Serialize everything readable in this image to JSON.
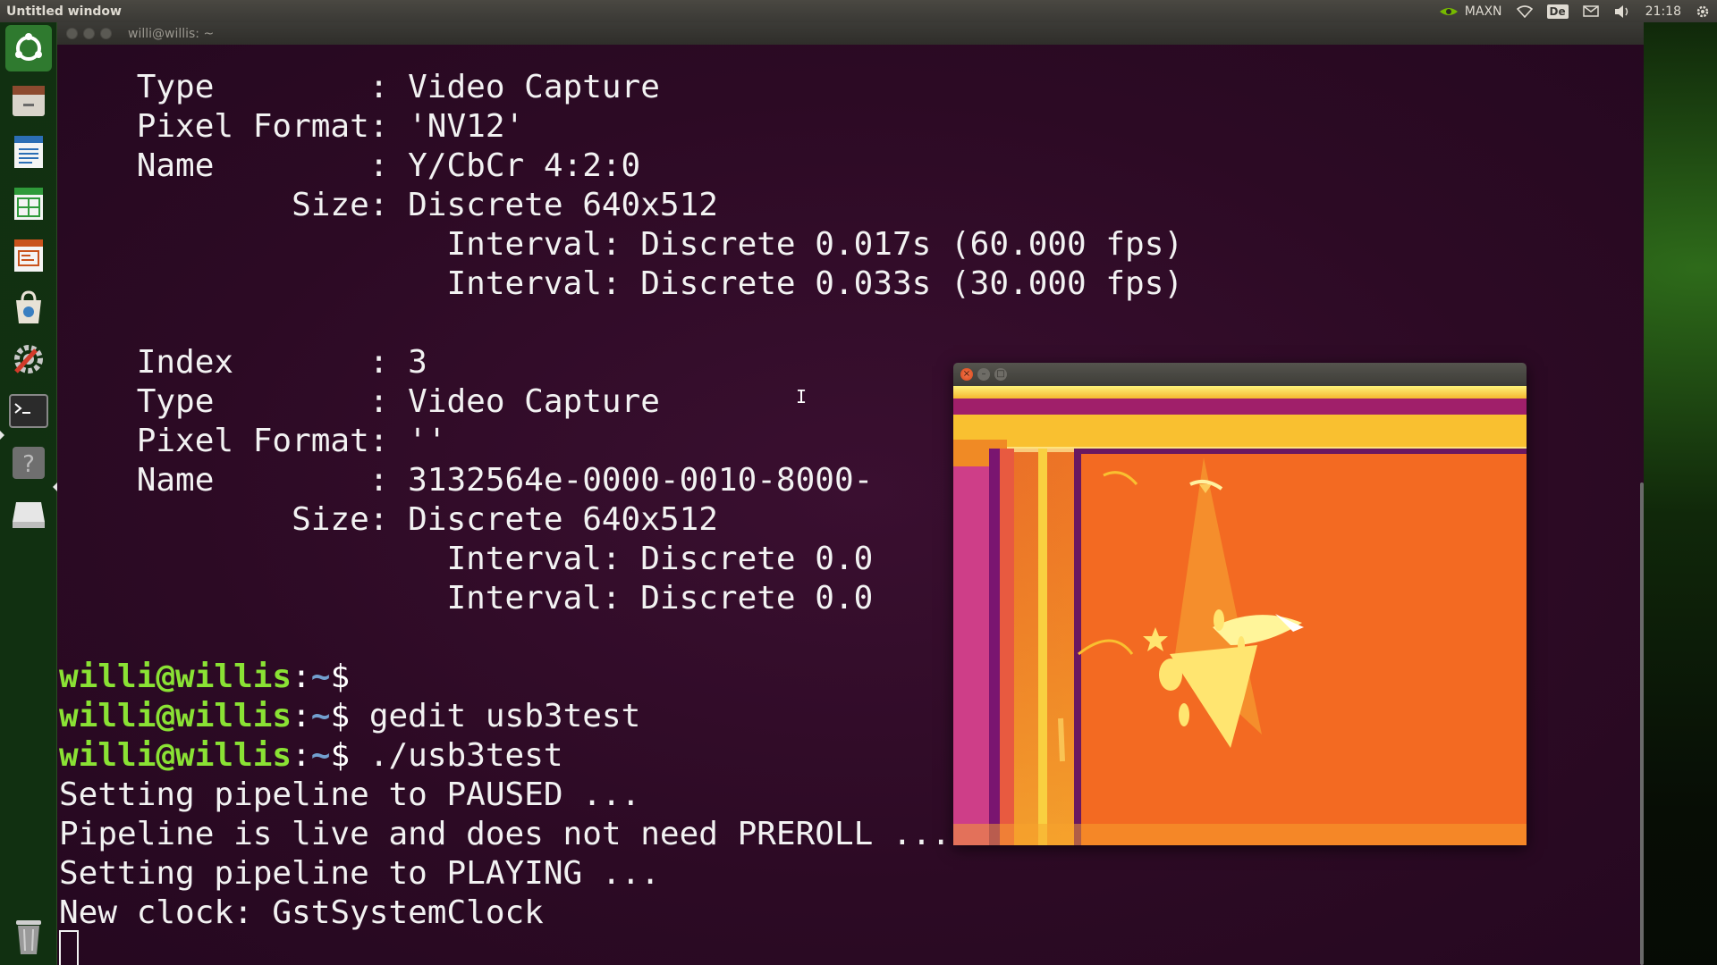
{
  "top_panel": {
    "window_title": "Untitled window",
    "power_mode": "MAXN",
    "keyboard_layout": "De",
    "clock": "21:18",
    "icons": [
      "nvidia-icon",
      "wifi-icon",
      "keyboard-icon",
      "mail-icon",
      "volume-icon",
      "gear-icon"
    ]
  },
  "launcher": {
    "items": [
      {
        "name": "ubuntu-dash-icon"
      },
      {
        "name": "file-manager-icon"
      },
      {
        "name": "writer-icon"
      },
      {
        "name": "calc-icon"
      },
      {
        "name": "impress-icon"
      },
      {
        "name": "software-center-icon"
      },
      {
        "name": "system-settings-icon"
      },
      {
        "name": "terminal-icon"
      },
      {
        "name": "help-icon"
      },
      {
        "name": "drive-icon"
      },
      {
        "name": "trash-icon"
      }
    ]
  },
  "terminal": {
    "title": "willi@willis: ~",
    "lines": [
      "    Type        : Video Capture",
      "    Pixel Format: 'NV12'",
      "    Name        : Y/CbCr 4:2:0",
      "            Size: Discrete 640x512",
      "                    Interval: Discrete 0.017s (60.000 fps)",
      "                    Interval: Discrete 0.033s (30.000 fps)",
      "",
      "    Index       : 3",
      "    Type        : Video Capture",
      "    Pixel Format: ''",
      "    Name        : 3132564e-0000-0010-8000-",
      "            Size: Discrete 640x512",
      "                    Interval: Discrete 0.0",
      "                    Interval: Discrete 0.0",
      ""
    ],
    "prompt_user": "willi@willis",
    "prompt_path": "~",
    "prompt_symbol": "$",
    "commands": [
      "",
      " gedit usb3test",
      " ./usb3test"
    ],
    "output": [
      "Setting pipeline to PAUSED ...",
      "Pipeline is live and does not need PREROLL ...",
      "Setting pipeline to PLAYING ...",
      "New clock: GstSystemClock"
    ]
  },
  "video_window": {
    "content": "thermal-camera-frame"
  }
}
